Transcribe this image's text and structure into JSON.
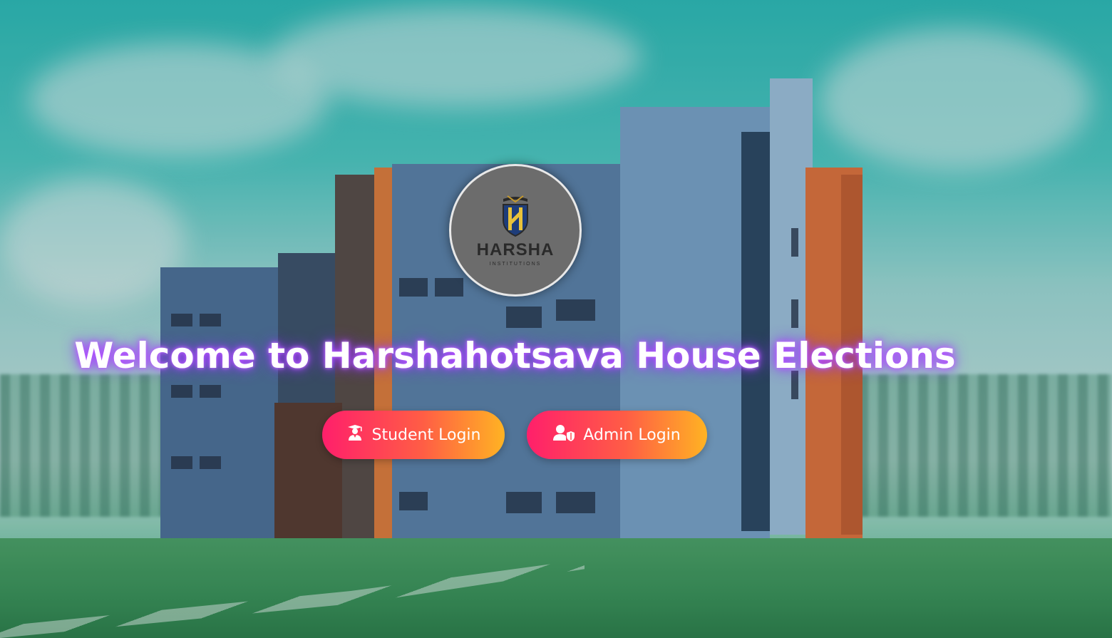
{
  "logo": {
    "name": "HARSHA",
    "subtitle": "INSTITUTIONS"
  },
  "hero": {
    "title": "Welcome to Harshahotsava House Elections"
  },
  "actions": {
    "student_login": {
      "label": "Student Login",
      "icon": "student-icon"
    },
    "admin_login": {
      "label": "Admin Login",
      "icon": "admin-user-icon"
    }
  },
  "colors": {
    "button_gradient_start": "#ff1f6b",
    "button_gradient_end": "#ffb323",
    "title_glow": "#b44cff",
    "logo_bg": "#6c6c6c"
  }
}
